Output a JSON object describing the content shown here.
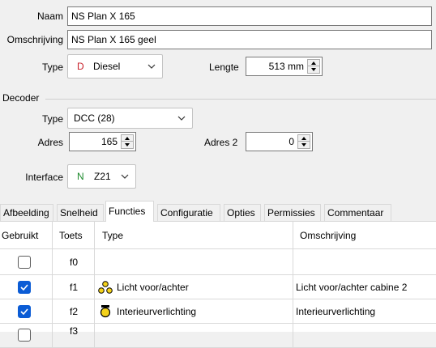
{
  "general": {
    "name_label": "Naam",
    "name_value": "NS Plan X 165",
    "description_label": "Omschrijving",
    "description_value": "NS Plan X 165 geel",
    "type_label": "Type",
    "type_letter": "D",
    "type_value": "Diesel",
    "length_label": "Lengte",
    "length_value": "513 mm"
  },
  "decoder": {
    "section_label": "Decoder",
    "type_label": "Type",
    "type_value": "DCC (28)",
    "address_label": "Adres",
    "address_value": "165",
    "address2_label": "Adres 2",
    "address2_value": "0",
    "interface_label": "Interface",
    "interface_letter": "N",
    "interface_value": "Z21"
  },
  "tabs": [
    "Afbeelding",
    "Snelheid",
    "Functies",
    "Configuratie",
    "Opties",
    "Permissies",
    "Commentaar"
  ],
  "active_tab": "Functies",
  "table": {
    "headers": [
      "Gebruikt",
      "Toets",
      "Type",
      "Omschrijving"
    ],
    "rows": [
      {
        "checked": false,
        "key": "f0",
        "type": "",
        "description": ""
      },
      {
        "checked": true,
        "key": "f1",
        "type": "Licht voor/achter",
        "description": "Licht voor/achter cabine 2"
      },
      {
        "checked": true,
        "key": "f2",
        "type": "Interieurverlichting",
        "description": "Interieurverlichting"
      },
      {
        "checked": false,
        "key": "f3",
        "type": "",
        "description": ""
      }
    ]
  },
  "colors": {
    "diesel_letter": "#c8202a",
    "interface_letter": "#1d8a2c",
    "checkbox_checked": "#0b5cd5",
    "lamp_yellow": "#f4d21a"
  },
  "icons": {
    "f1_type": "headlights-icon",
    "f2_type": "interior-lamp-icon"
  }
}
